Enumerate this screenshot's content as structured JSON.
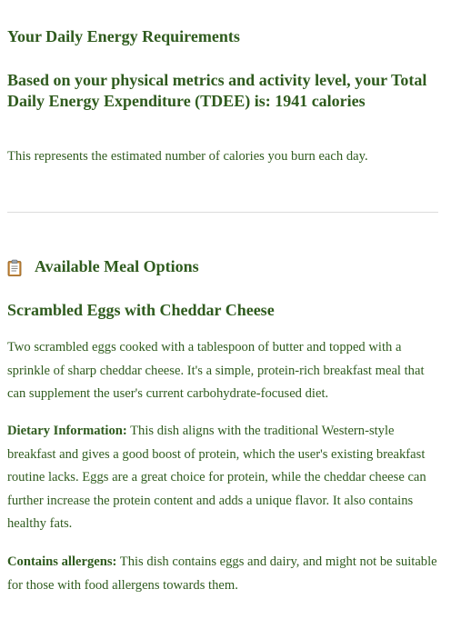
{
  "energy": {
    "heading": "Your Daily Energy Requirements",
    "tdee_line": "Based on your physical metrics and activity level, your Total Daily Energy Expenditure (TDEE) is: 1941 calories",
    "description": "This represents the estimated number of calories you burn each day."
  },
  "meals": {
    "icon": "clipboard-icon",
    "heading": "Available Meal Options",
    "dish": {
      "name": "Scrambled Eggs with Cheddar Cheese",
      "description": "Two scrambled eggs cooked with a tablespoon of butter and topped with a sprinkle of sharp cheddar cheese. It's a simple, protein-rich breakfast meal that can supplement the user's current carbohydrate-focused diet.",
      "dietary_label": "Dietary Information:",
      "dietary_text": " This dish aligns with the traditional Western-style breakfast and gives a good boost of protein, which the user's existing breakfast routine lacks. Eggs are a great choice for protein, while the cheddar cheese can further increase the protein content and adds a unique flavor. It also contains healthy fats.",
      "allergen_label": "Contains allergens:",
      "allergen_text": " This dish contains eggs and dairy, and might not be suitable for those with food allergens towards them."
    }
  },
  "colors": {
    "text": "#2f5b1e",
    "divider": "#dcdcdc"
  }
}
